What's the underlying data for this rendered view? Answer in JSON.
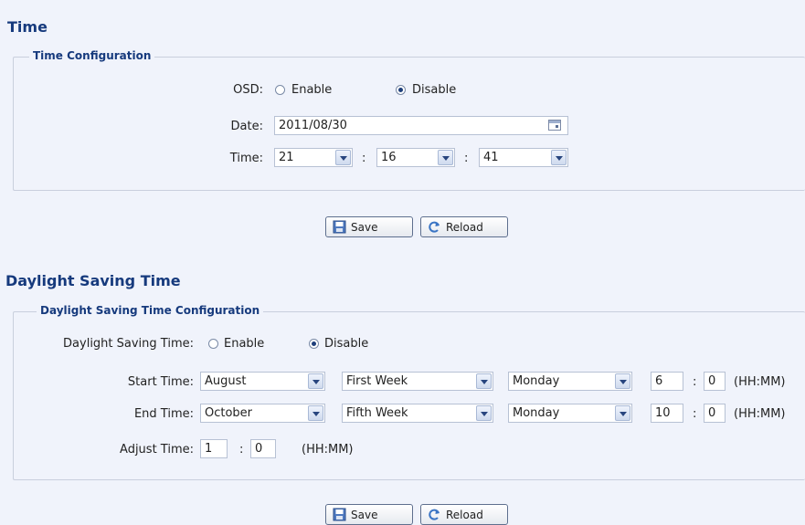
{
  "time_section": {
    "title": "Time",
    "config_legend": "Time Configuration",
    "osd_label": "OSD:",
    "enable_label": "Enable",
    "disable_label": "Disable",
    "osd_selected": "Disable",
    "date_label": "Date:",
    "date_value": "2011/08/30",
    "time_label": "Time:",
    "hour": "21",
    "minute": "16",
    "second": "41",
    "colon": ":",
    "save_label": "Save",
    "reload_label": "Reload"
  },
  "dst_section": {
    "title": "Daylight Saving Time",
    "config_legend": "Daylight Saving Time Configuration",
    "dst_label": "Daylight Saving Time:",
    "enable_label": "Enable",
    "disable_label": "Disable",
    "dst_selected": "Disable",
    "start_label": "Start Time:",
    "start_month": "August",
    "start_week": "First Week",
    "start_day": "Monday",
    "start_hour": "6",
    "start_minute": "0",
    "end_label": "End Time:",
    "end_month": "October",
    "end_week": "Fifth Week",
    "end_day": "Monday",
    "end_hour": "10",
    "end_minute": "0",
    "hhmm": "(HH:MM)",
    "adjust_label": "Adjust Time:",
    "adjust_hour": "1",
    "adjust_minute": "0",
    "colon": ":",
    "save_label": "Save",
    "reload_label": "Reload"
  }
}
